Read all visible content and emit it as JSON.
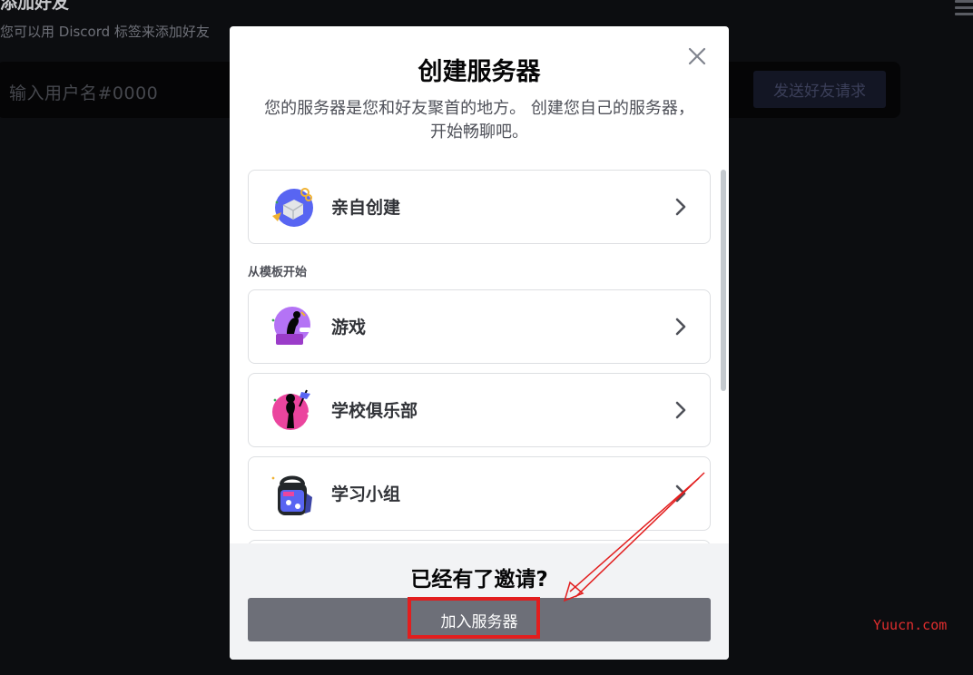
{
  "background": {
    "title": "添加好友",
    "description": "您可以用 Discord 标签来添加好友",
    "input_placeholder": "输入用户名#0000",
    "send_button": "发送好友请求",
    "menu_icon": "hamburger-icon"
  },
  "modal": {
    "title": "创建服务器",
    "subtitle": "您的服务器是您和好友聚首的地方。 创建您自己的服务器，开始畅聊吧。",
    "close_icon": "close-icon",
    "create_own": {
      "label": "亲自创建",
      "icon": "create-illustration-icon"
    },
    "section_label": "从模板开始",
    "templates": [
      {
        "label": "游戏",
        "icon": "gaming-illustration-icon"
      },
      {
        "label": "学校俱乐部",
        "icon": "school-club-illustration-icon"
      },
      {
        "label": "学习小组",
        "icon": "study-group-illustration-icon"
      }
    ],
    "footer": {
      "title": "已经有了邀请?",
      "join_button": "加入服务器"
    }
  },
  "watermark": "Yuucn.com",
  "colors": {
    "backdrop": "#0c0d10",
    "modal_bg": "#ffffff",
    "footer_bg": "#f2f3f5",
    "join_button": "#6d6f78",
    "annotation": "#e21e1e"
  }
}
